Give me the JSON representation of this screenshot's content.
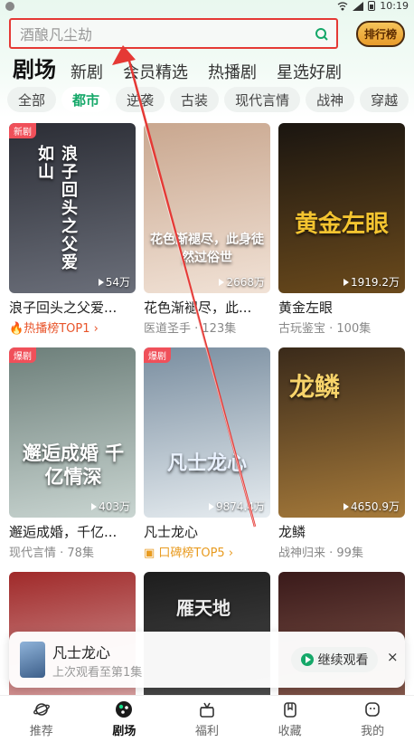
{
  "status": {
    "time": "10:19"
  },
  "search": {
    "placeholder": "酒酿凡尘劫"
  },
  "rank_button": {
    "label": "排行榜"
  },
  "main_tabs": [
    {
      "label": "剧场",
      "active": true
    },
    {
      "label": "新剧"
    },
    {
      "label": "会员精选"
    },
    {
      "label": "热播剧"
    },
    {
      "label": "星选好剧"
    }
  ],
  "sub_tabs": [
    {
      "label": "全部"
    },
    {
      "label": "都市",
      "active": true
    },
    {
      "label": "逆袭"
    },
    {
      "label": "古装"
    },
    {
      "label": "现代言情"
    },
    {
      "label": "战神"
    },
    {
      "label": "穿越"
    }
  ],
  "cards": [
    {
      "title": "浪子回头之父爱...",
      "sub": "热播榜TOP1 ›",
      "sub_type": "hot",
      "views": "54万",
      "badge": "新剧",
      "poster_text": "浪子回头之父爱如山",
      "colors": [
        "#2b2d35",
        "#6b6f7a"
      ]
    },
    {
      "title": "花色渐褪尽，此...",
      "sub": "医道圣手 · 123集",
      "views": "2668万",
      "badge": "",
      "poster_text": "花色渐褪尽，此身徒然过俗世",
      "colors": [
        "#c9a78f",
        "#f1e2d6"
      ]
    },
    {
      "title": "黄金左眼",
      "sub": "古玩鉴宝 · 100集",
      "views": "1919.2万",
      "badge": "",
      "poster_text": "黄金左眼",
      "colors": [
        "#1a1510",
        "#6b4a1c"
      ]
    },
    {
      "title": "邂逅成婚，千亿...",
      "sub": "现代言情 · 78集",
      "views": "403万",
      "badge": "爆剧",
      "poster_text": "邂逅成婚 千亿情深",
      "colors": [
        "#6d7f7a",
        "#c9d5d1"
      ]
    },
    {
      "title": "凡士龙心",
      "sub": "口碑榜TOP5 ›",
      "sub_type": "praise",
      "views": "9874.4万",
      "badge": "爆剧",
      "poster_text": "凡士龙心",
      "colors": [
        "#7a8ea0",
        "#e6ecf0"
      ]
    },
    {
      "title": "龙鳞",
      "sub": "战神归来 · 99集",
      "views": "4650.9万",
      "badge": "",
      "poster_text": "龙鳞",
      "colors": [
        "#3a2a1a",
        "#a67a3a"
      ]
    },
    {
      "title": "",
      "sub": "",
      "views": "",
      "badge": "",
      "poster_text": "",
      "colors": [
        "#a02a2a",
        "#e6c2c2"
      ]
    },
    {
      "title": "",
      "sub": "",
      "views": "",
      "badge": "",
      "poster_text": "雁天地",
      "colors": [
        "#1d1d1d",
        "#5a5a5a"
      ]
    },
    {
      "title": "",
      "sub": "",
      "views": "",
      "badge": "",
      "poster_text": "",
      "colors": [
        "#3a1a1a",
        "#9a6a5a"
      ]
    }
  ],
  "continue_watching": {
    "title": "凡士龙心",
    "subtitle": "上次观看至第1集",
    "button_label": "继续观看",
    "close": "×"
  },
  "bottom_nav": [
    {
      "label": "推荐",
      "icon": "planet-icon"
    },
    {
      "label": "剧场",
      "icon": "theater-icon",
      "active": true
    },
    {
      "label": "福利",
      "icon": "gift-icon"
    },
    {
      "label": "收藏",
      "icon": "bookmark-icon"
    },
    {
      "label": "我的",
      "icon": "profile-icon"
    }
  ],
  "colors": {
    "accent": "#15a869",
    "annotation": "#e53935"
  }
}
